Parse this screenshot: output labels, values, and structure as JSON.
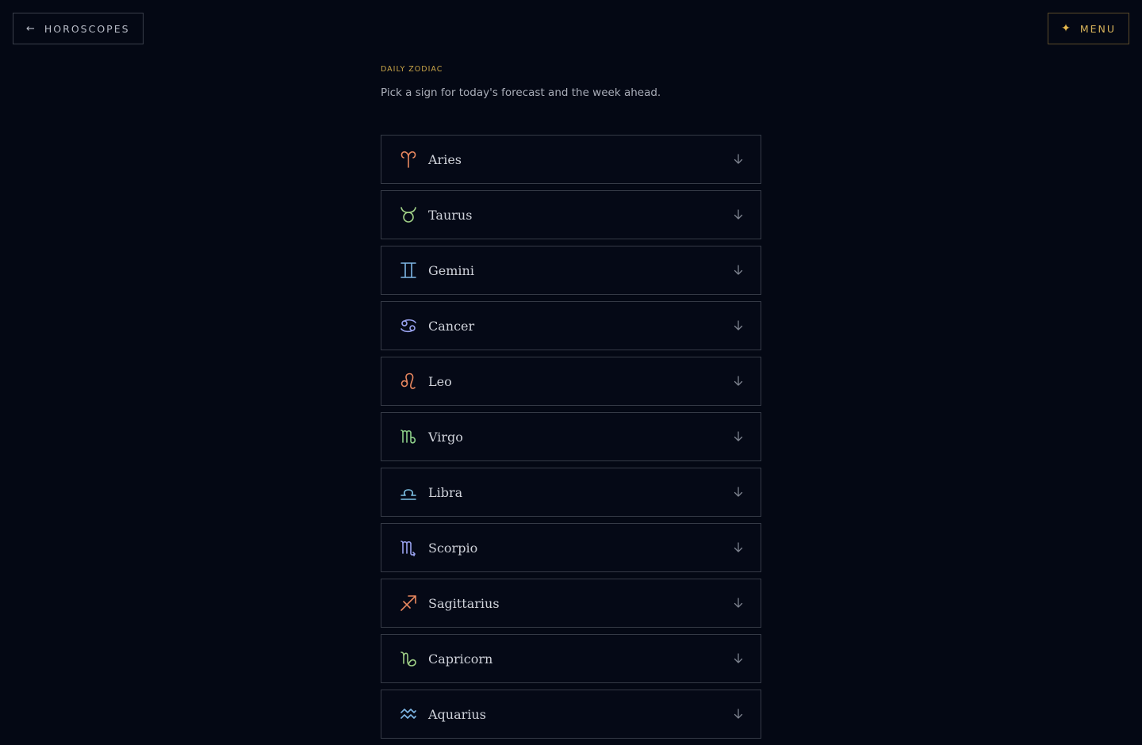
{
  "header": {
    "back_arrow": "←",
    "back_label": "HOROSCOPES",
    "menu_star": "✦",
    "menu_label": "MENU"
  },
  "main": {
    "eyebrow": "DAILY ZODIAC",
    "intro": "Pick a sign for today's forecast and the week ahead."
  },
  "signs": [
    {
      "name": "Aries",
      "icon": "aries-icon",
      "color": "#e8875f"
    },
    {
      "name": "Taurus",
      "icon": "taurus-icon",
      "color": "#9fcf86"
    },
    {
      "name": "Gemini",
      "icon": "gemini-icon",
      "color": "#7fb7e6"
    },
    {
      "name": "Cancer",
      "icon": "cancer-icon",
      "color": "#9aa3f0"
    },
    {
      "name": "Leo",
      "icon": "leo-icon",
      "color": "#e8875f"
    },
    {
      "name": "Virgo",
      "icon": "virgo-icon",
      "color": "#8ed08a"
    },
    {
      "name": "Libra",
      "icon": "libra-icon",
      "color": "#7fc3e6"
    },
    {
      "name": "Scorpio",
      "icon": "scorpio-icon",
      "color": "#9aa3f0"
    },
    {
      "name": "Sagittarius",
      "icon": "sagittarius-icon",
      "color": "#e8875f"
    },
    {
      "name": "Capricorn",
      "icon": "capricorn-icon",
      "color": "#9fcf86"
    },
    {
      "name": "Aquarius",
      "icon": "aquarius-icon",
      "color": "#7fb7e6"
    }
  ],
  "colors": {
    "background": "#040814",
    "accent": "#d8b35a",
    "border": "#353a46"
  }
}
